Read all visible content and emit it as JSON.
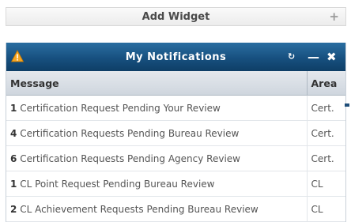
{
  "add_widget": {
    "label": "Add Widget",
    "plus": "+"
  },
  "widget": {
    "title": "My Notifications",
    "header_color": "#17507f",
    "warning_icon": "warning-triangle-icon",
    "refresh_glyph": "↻",
    "minimize_glyph": "—",
    "close_glyph": "✖",
    "columns": [
      "Message",
      "Area"
    ],
    "rows": [
      {
        "count": "1",
        "message": "Certification Request Pending Your Review",
        "area": "Cert."
      },
      {
        "count": "4",
        "message": "Certification Requests Pending Bureau Review",
        "area": "Cert."
      },
      {
        "count": "6",
        "message": "Certification Requests Pending Agency Review",
        "area": "Cert."
      },
      {
        "count": "1",
        "message": "CL Point Request Pending Bureau Review",
        "area": "CL"
      },
      {
        "count": "2",
        "message": "CL Achievement Requests Pending Bureau Review",
        "area": "CL"
      }
    ]
  }
}
